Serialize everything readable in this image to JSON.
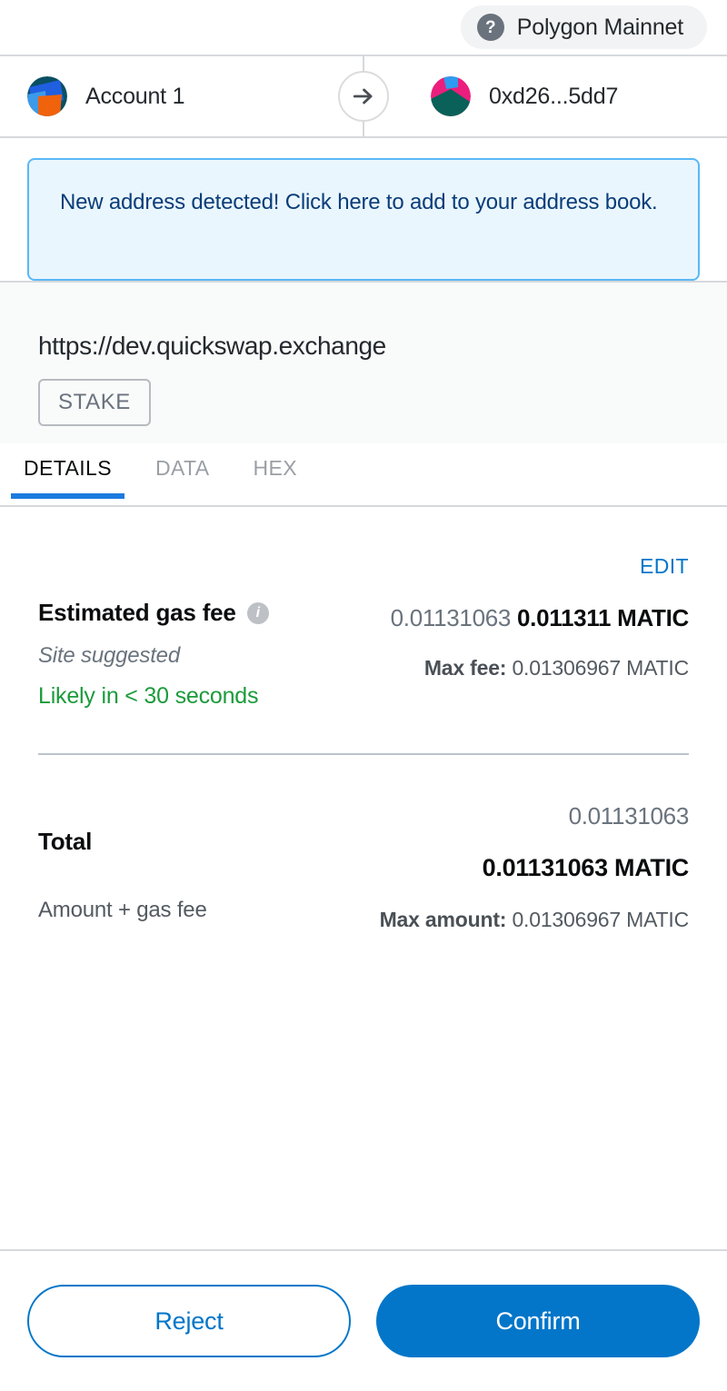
{
  "network": {
    "icon": "question-mark-icon",
    "name": "Polygon Mainnet"
  },
  "transfer": {
    "from_label": "Account 1",
    "from_avatar": "account-jazzicon",
    "arrow_icon": "arrow-right-icon",
    "to_label": "0xd26...5dd7",
    "to_avatar": "recipient-jazzicon"
  },
  "alert": {
    "message": "New address detected! Click here to add to your address book."
  },
  "origin": {
    "url": "https://dev.quickswap.exchange",
    "tag": "STAKE"
  },
  "tabs": [
    {
      "label": "DETAILS",
      "active": true
    },
    {
      "label": "DATA",
      "active": false
    },
    {
      "label": "HEX",
      "active": false
    }
  ],
  "details": {
    "edit_label": "EDIT",
    "gas_fee": {
      "title": "Estimated gas fee",
      "info_icon": "info-icon",
      "suggestion": "Site suggested",
      "speed": "Likely in < 30 seconds",
      "secondary_value": "0.01131063",
      "primary_value": "0.011311 MATIC",
      "max_fee_label": "Max fee:",
      "max_fee_value": "0.01306967 MATIC"
    },
    "total": {
      "title": "Total",
      "subtitle": "Amount + gas fee",
      "secondary_value": "0.01131063",
      "primary_value": "0.01131063 MATIC",
      "max_amount_label": "Max amount:",
      "max_amount_value": "0.01306967 MATIC"
    }
  },
  "footer": {
    "reject_label": "Reject",
    "confirm_label": "Confirm"
  },
  "colors": {
    "accent": "#0376c9",
    "tab_underline": "#1c7ae0",
    "success": "#1c9b3c",
    "alert_border": "#5ab8f7",
    "alert_bg": "#eaf6fd",
    "alert_text": "#0a3d7a"
  }
}
